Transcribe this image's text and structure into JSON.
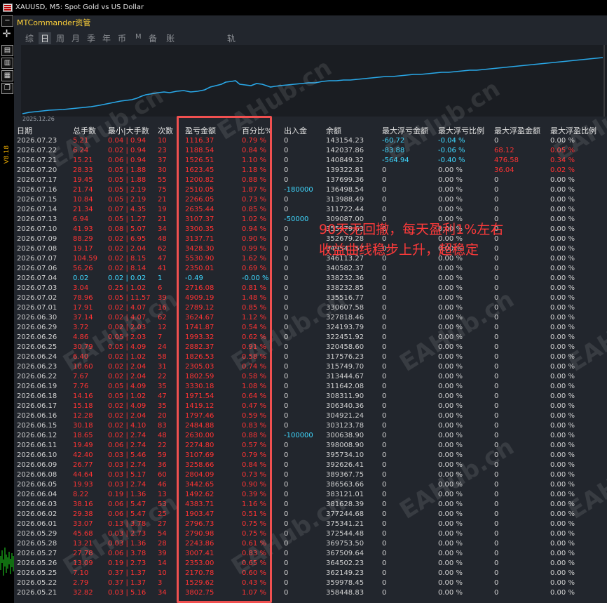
{
  "window": {
    "title": "XAUUSD, M5:  Spot Gold vs US Dollar"
  },
  "left_toolbar": {
    "icons": [
      "minimize-icon",
      "crosshair-icon",
      "chart-icon",
      "table-icon",
      "grid-icon",
      "restore-icon"
    ],
    "version_label": "V8.18"
  },
  "app": {
    "title": "MTCommander资管"
  },
  "tabs": [
    "综",
    "日",
    "周",
    "月",
    "季",
    "年",
    "币",
    "M",
    "备",
    "账户",
    "轨迹"
  ],
  "selected_tab": "日",
  "equity_chart": {
    "start_date_label": "2025.12.26",
    "line_color": "#29a8e8"
  },
  "table": {
    "headers": [
      "日期",
      "总手数",
      "最小|大手数",
      "次数",
      "盈亏金额",
      "百分比%",
      "出入金",
      "余额",
      "最大浮亏金额",
      "最大浮亏比例",
      "最大浮盈金额",
      "最大浮盈比例"
    ],
    "rows": [
      [
        "2026.07.23",
        "5.21",
        "0.04 | 0.94",
        "10",
        "1116.37",
        "0.79 %",
        "0",
        "143154.23",
        "-60.72",
        "-0.04 %",
        "0",
        "0.00 %"
      ],
      [
        "2026.07.22",
        "6.24",
        "0.02 | 0.94",
        "23",
        "1188.54",
        "0.84 %",
        "0",
        "142037.86",
        "-83.88",
        "-0.06 %",
        "68.12",
        "0.05 %"
      ],
      [
        "2026.07.21",
        "15.21",
        "0.06 | 0.94",
        "37",
        "1526.51",
        "1.10 %",
        "0",
        "140849.32",
        "-564.94",
        "-0.40 %",
        "476.58",
        "0.34 %"
      ],
      [
        "2026.07.20",
        "28.33",
        "0.05 | 1.88",
        "30",
        "1623.45",
        "1.18 %",
        "0",
        "139322.81",
        "0",
        "0.00 %",
        "36.04",
        "0.02 %"
      ],
      [
        "2026.07.17",
        "19.45",
        "0.05 | 1.88",
        "55",
        "1200.82",
        "0.88 %",
        "0",
        "137699.36",
        "0",
        "0.00 %",
        "0",
        "0.00 %"
      ],
      [
        "2026.07.16",
        "21.74",
        "0.05 | 2.19",
        "75",
        "2510.05",
        "1.87 %",
        "-180000",
        "136498.54",
        "0",
        "0.00 %",
        "0",
        "0.00 %"
      ],
      [
        "2026.07.15",
        "10.84",
        "0.05 | 2.19",
        "21",
        "2266.05",
        "0.73 %",
        "0",
        "313988.49",
        "0",
        "0.00 %",
        "0",
        "0.00 %"
      ],
      [
        "2026.07.14",
        "21.34",
        "0.07 | 4.35",
        "19",
        "2635.44",
        "0.85 %",
        "0",
        "311722.44",
        "0",
        "0.00 %",
        "0",
        "0.00 %"
      ],
      [
        "2026.07.13",
        "6.94",
        "0.05 | 1.27",
        "21",
        "3107.37",
        "1.02 %",
        "-50000",
        "309087.00",
        "0",
        "0.00 %",
        "0",
        "0.00 %"
      ],
      [
        "2026.07.10",
        "41.93",
        "0.08 | 5.07",
        "34",
        "3300.35",
        "0.94 %",
        "0",
        "355979.63",
        "0",
        "0.00 %",
        "0",
        "0.00 %"
      ],
      [
        "2026.07.09",
        "88.29",
        "0.02 | 6.95",
        "48",
        "3137.71",
        "0.90 %",
        "0",
        "352679.28",
        "0",
        "0.00 %",
        "0",
        "0.00 %"
      ],
      [
        "2026.07.08",
        "19.17",
        "0.02 | 2.04",
        "62",
        "3428.30",
        "0.99 %",
        "0",
        "349541.57",
        "0",
        "0.00 %",
        "0",
        "0.00 %"
      ],
      [
        "2026.07.07",
        "104.59",
        "0.02 | 8.15",
        "47",
        "5530.90",
        "1.62 %",
        "0",
        "346113.27",
        "0",
        "0.00 %",
        "0",
        "0.00 %"
      ],
      [
        "2026.07.06",
        "56.26",
        "0.02 | 8.14",
        "41",
        "2350.01",
        "0.69 %",
        "0",
        "340582.37",
        "0",
        "0.00 %",
        "0",
        "0.00 %"
      ],
      [
        "2026.07.04",
        "0.02",
        "0.02 | 0.02",
        "1",
        "-0.49",
        "-0.00 %",
        "0",
        "338232.36",
        "0",
        "0.00 %",
        "0",
        "0.00 %"
      ],
      [
        "2026.07.03",
        "3.04",
        "0.25 | 1.02",
        "6",
        "2716.08",
        "0.81 %",
        "0",
        "338232.85",
        "0",
        "0.00 %",
        "0",
        "0.00 %"
      ],
      [
        "2026.07.02",
        "78.96",
        "0.05 | 11.57",
        "39",
        "4909.19",
        "1.48 %",
        "0",
        "335516.77",
        "0",
        "0.00 %",
        "0",
        "0.00 %"
      ],
      [
        "2026.07.01",
        "17.91",
        "0.02 | 4.07",
        "16",
        "2789.12",
        "0.85 %",
        "0",
        "330607.58",
        "0",
        "0.00 %",
        "0",
        "0.00 %"
      ],
      [
        "2026.06.30",
        "37.14",
        "0.02 | 4.07",
        "62",
        "3624.67",
        "1.12 %",
        "0",
        "327818.46",
        "0",
        "0.00 %",
        "0",
        "0.00 %"
      ],
      [
        "2026.06.29",
        "3.72",
        "0.02 | 2.03",
        "12",
        "1741.87",
        "0.54 %",
        "0",
        "324193.79",
        "0",
        "0.00 %",
        "0",
        "0.00 %"
      ],
      [
        "2026.06.26",
        "4.86",
        "0.05 | 2.03",
        "7",
        "1993.32",
        "0.62 %",
        "0",
        "322451.92",
        "0",
        "0.00 %",
        "0",
        "0.00 %"
      ],
      [
        "2026.06.25",
        "30.79",
        "0.05 | 4.09",
        "24",
        "2882.37",
        "0.91 %",
        "0",
        "320458.60",
        "0",
        "0.00 %",
        "0",
        "0.00 %"
      ],
      [
        "2026.06.24",
        "6.40",
        "0.02 | 1.02",
        "58",
        "1826.53",
        "0.58 %",
        "0",
        "317576.23",
        "0",
        "0.00 %",
        "0",
        "0.00 %"
      ],
      [
        "2026.06.23",
        "10.60",
        "0.02 | 2.04",
        "31",
        "2305.03",
        "0.74 %",
        "0",
        "315749.70",
        "0",
        "0.00 %",
        "0",
        "0.00 %"
      ],
      [
        "2026.06.22",
        "7.67",
        "0.02 | 2.04",
        "22",
        "1802.59",
        "0.58 %",
        "0",
        "313444.67",
        "0",
        "0.00 %",
        "0",
        "0.00 %"
      ],
      [
        "2026.06.19",
        "7.76",
        "0.05 | 4.09",
        "35",
        "3330.18",
        "1.08 %",
        "0",
        "311642.08",
        "0",
        "0.00 %",
        "0",
        "0.00 %"
      ],
      [
        "2026.06.18",
        "14.16",
        "0.05 | 1.02",
        "47",
        "1971.54",
        "0.64 %",
        "0",
        "308311.90",
        "0",
        "0.00 %",
        "0",
        "0.00 %"
      ],
      [
        "2026.06.17",
        "15.18",
        "0.02 | 4.09",
        "35",
        "1419.12",
        "0.47 %",
        "0",
        "306340.36",
        "0",
        "0.00 %",
        "0",
        "0.00 %"
      ],
      [
        "2026.06.16",
        "12.28",
        "0.02 | 2.04",
        "20",
        "1797.46",
        "0.59 %",
        "0",
        "304921.24",
        "0",
        "0.00 %",
        "0",
        "0.00 %"
      ],
      [
        "2026.06.15",
        "30.18",
        "0.02 | 4.10",
        "83",
        "2484.88",
        "0.83 %",
        "0",
        "303123.78",
        "0",
        "0.00 %",
        "0",
        "0.00 %"
      ],
      [
        "2026.06.12",
        "18.65",
        "0.02 | 2.74",
        "48",
        "2630.00",
        "0.88 %",
        "-100000",
        "300638.90",
        "0",
        "0.00 %",
        "0",
        "0.00 %"
      ],
      [
        "2026.06.11",
        "19.49",
        "0.06 | 2.74",
        "22",
        "2274.80",
        "0.57 %",
        "0",
        "398008.90",
        "0",
        "0.00 %",
        "0",
        "0.00 %"
      ],
      [
        "2026.06.10",
        "42.40",
        "0.03 | 5.46",
        "59",
        "3107.69",
        "0.79 %",
        "0",
        "395734.10",
        "0",
        "0.00 %",
        "0",
        "0.00 %"
      ],
      [
        "2026.06.09",
        "26.77",
        "0.03 | 2.74",
        "36",
        "3258.66",
        "0.84 %",
        "0",
        "392626.41",
        "0",
        "0.00 %",
        "0",
        "0.00 %"
      ],
      [
        "2026.06.08",
        "44.64",
        "0.03 | 5.17",
        "60",
        "2804.09",
        "0.73 %",
        "0",
        "389367.75",
        "0",
        "0.00 %",
        "0",
        "0.00 %"
      ],
      [
        "2026.06.05",
        "19.93",
        "0.03 | 2.74",
        "46",
        "3442.65",
        "0.90 %",
        "0",
        "386563.66",
        "0",
        "0.00 %",
        "0",
        "0.00 %"
      ],
      [
        "2026.06.04",
        "8.22",
        "0.19 | 1.36",
        "13",
        "1492.62",
        "0.39 %",
        "0",
        "383121.01",
        "0",
        "0.00 %",
        "0",
        "0.00 %"
      ],
      [
        "2026.06.03",
        "38.16",
        "0.06 | 5.47",
        "53",
        "4383.71",
        "1.16 %",
        "0",
        "381628.39",
        "0",
        "0.00 %",
        "0",
        "0.00 %"
      ],
      [
        "2026.06.02",
        "29.38",
        "0.06 | 5.47",
        "25",
        "1903.47",
        "0.51 %",
        "0",
        "377244.68",
        "0",
        "0.00 %",
        "0",
        "0.00 %"
      ],
      [
        "2026.06.01",
        "33.07",
        "0.13 | 3.78",
        "27",
        "2796.73",
        "0.75 %",
        "0",
        "375341.21",
        "0",
        "0.00 %",
        "0",
        "0.00 %"
      ],
      [
        "2026.05.29",
        "45.68",
        "0.03 | 2.73",
        "54",
        "2790.98",
        "0.75 %",
        "0",
        "372544.48",
        "0",
        "0.00 %",
        "0",
        "0.00 %"
      ],
      [
        "2026.05.28",
        "13.21",
        "0.03 | 1.36",
        "28",
        "2243.86",
        "0.61 %",
        "0",
        "369753.50",
        "0",
        "0.00 %",
        "0",
        "0.00 %"
      ],
      [
        "2026.05.27",
        "27.78",
        "0.06 | 3.78",
        "39",
        "3007.41",
        "0.83 %",
        "0",
        "367509.64",
        "0",
        "0.00 %",
        "0",
        "0.00 %"
      ],
      [
        "2026.05.26",
        "13.09",
        "0.19 | 2.73",
        "14",
        "2353.00",
        "0.65 %",
        "0",
        "364502.23",
        "0",
        "0.00 %",
        "0",
        "0.00 %"
      ],
      [
        "2026.05.25",
        "7.10",
        "0.37 | 1.37",
        "10",
        "2170.78",
        "0.60 %",
        "0",
        "362149.23",
        "0",
        "0.00 %",
        "0",
        "0.00 %"
      ],
      [
        "2026.05.22",
        "2.79",
        "0.37 | 1.37",
        "3",
        "1529.62",
        "0.43 %",
        "0",
        "359978.45",
        "0",
        "0.00 %",
        "0",
        "0.00 %"
      ],
      [
        "2026.05.21",
        "32.82",
        "0.03 | 5.16",
        "34",
        "3802.75",
        "1.07 %",
        "0",
        "358448.83",
        "0",
        "0.00 %",
        "0",
        "0.00 %"
      ]
    ]
  },
  "annotation": {
    "line1": "90天无回撤，每天盈利1%左右",
    "line2": "收益曲线稳步上升，超稳定",
    "color": "#ff3a3a"
  },
  "watermark": {
    "text": "EAHub.cn"
  }
}
